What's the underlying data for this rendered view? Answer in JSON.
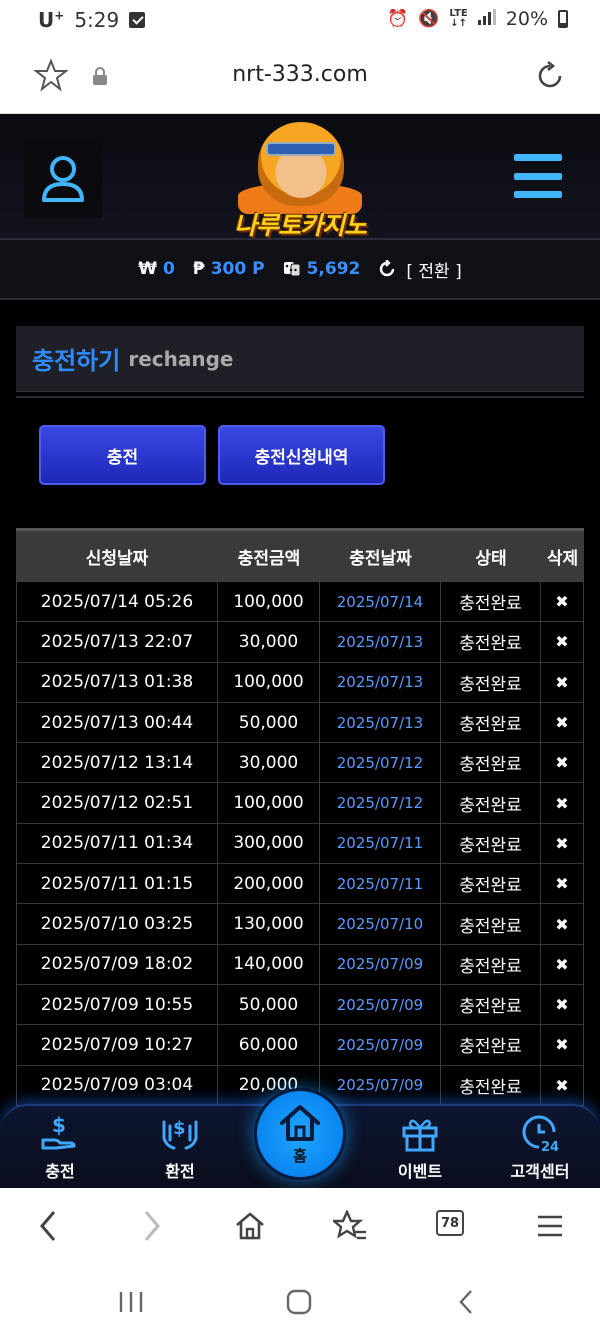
{
  "status_bar": {
    "carrier": "U",
    "carrier_sup": "+",
    "time": "5:29",
    "network": "LTE",
    "battery": "20%"
  },
  "browser": {
    "url": "nrt-333.com",
    "tabs_count": "78"
  },
  "site": {
    "logo_text": "나루토카지노",
    "balance": {
      "won_symbol": "₩",
      "won_value": "0",
      "point_symbol": "₱",
      "point_value": "300 P",
      "chip_value": "5,692",
      "switch_label": "[ 전환 ]"
    },
    "section": {
      "title_ko": "충전하기",
      "title_en": "rechange"
    },
    "buttons": {
      "charge": "충전",
      "history": "충전신청내역"
    },
    "table": {
      "headers": [
        "신청날짜",
        "충전금액",
        "충전날짜",
        "상태",
        "삭제"
      ],
      "rows": [
        {
          "requested": "2025/07/14 05:26",
          "amount": "100,000",
          "charged": "2025/07/14",
          "status": "충전완료",
          "delete": "✖"
        },
        {
          "requested": "2025/07/13 22:07",
          "amount": "30,000",
          "charged": "2025/07/13",
          "status": "충전완료",
          "delete": "✖"
        },
        {
          "requested": "2025/07/13 01:38",
          "amount": "100,000",
          "charged": "2025/07/13",
          "status": "충전완료",
          "delete": "✖"
        },
        {
          "requested": "2025/07/13 00:44",
          "amount": "50,000",
          "charged": "2025/07/13",
          "status": "충전완료",
          "delete": "✖"
        },
        {
          "requested": "2025/07/12 13:14",
          "amount": "30,000",
          "charged": "2025/07/12",
          "status": "충전완료",
          "delete": "✖"
        },
        {
          "requested": "2025/07/12 02:51",
          "amount": "100,000",
          "charged": "2025/07/12",
          "status": "충전완료",
          "delete": "✖"
        },
        {
          "requested": "2025/07/11 01:34",
          "amount": "300,000",
          "charged": "2025/07/11",
          "status": "충전완료",
          "delete": "✖"
        },
        {
          "requested": "2025/07/11 01:15",
          "amount": "200,000",
          "charged": "2025/07/11",
          "status": "충전완료",
          "delete": "✖"
        },
        {
          "requested": "2025/07/10 03:25",
          "amount": "130,000",
          "charged": "2025/07/10",
          "status": "충전완료",
          "delete": "✖"
        },
        {
          "requested": "2025/07/09 18:02",
          "amount": "140,000",
          "charged": "2025/07/09",
          "status": "충전완료",
          "delete": "✖"
        },
        {
          "requested": "2025/07/09 10:55",
          "amount": "50,000",
          "charged": "2025/07/09",
          "status": "충전완료",
          "delete": "✖"
        },
        {
          "requested": "2025/07/09 10:27",
          "amount": "60,000",
          "charged": "2025/07/09",
          "status": "충전완료",
          "delete": "✖"
        },
        {
          "requested": "2025/07/09 03:04",
          "amount": "20,000",
          "charged": "2025/07/09",
          "status": "충전완료",
          "delete": "✖"
        }
      ]
    },
    "bottom_nav": {
      "charge": "충전",
      "exchange": "환전",
      "home": "홈",
      "event": "이벤트",
      "support": "고객센터"
    }
  },
  "colors": {
    "accent_blue": "#2f8dff",
    "button_blue": "#2a36d0",
    "menu_cyan": "#3fb6ff",
    "home_blue": "#0a86f0"
  }
}
